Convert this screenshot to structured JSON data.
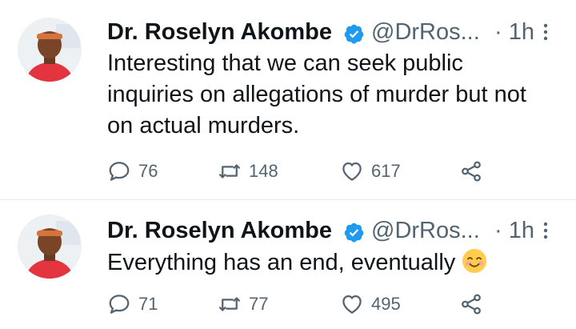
{
  "tweets": [
    {
      "author_name": "Dr. Roselyn Akombe",
      "handle": "@DrRos...",
      "time": "· 1h",
      "text": "Interesting that we can seek public inquiries on allegations of murder but not on actual murders.",
      "replies": "76",
      "retweets": "148",
      "likes": "617"
    },
    {
      "author_name": "Dr. Roselyn Akombe",
      "handle": "@DrRos...",
      "time": "· 1h",
      "text": "Everything has an end, eventually",
      "emoji": "smiling-face-emoji",
      "replies": "71",
      "retweets": "77",
      "likes": "495"
    }
  ],
  "colors": {
    "verified_badge": "#1d9bf0",
    "secondary_text": "#536471",
    "divider": "#e6ecf0"
  }
}
